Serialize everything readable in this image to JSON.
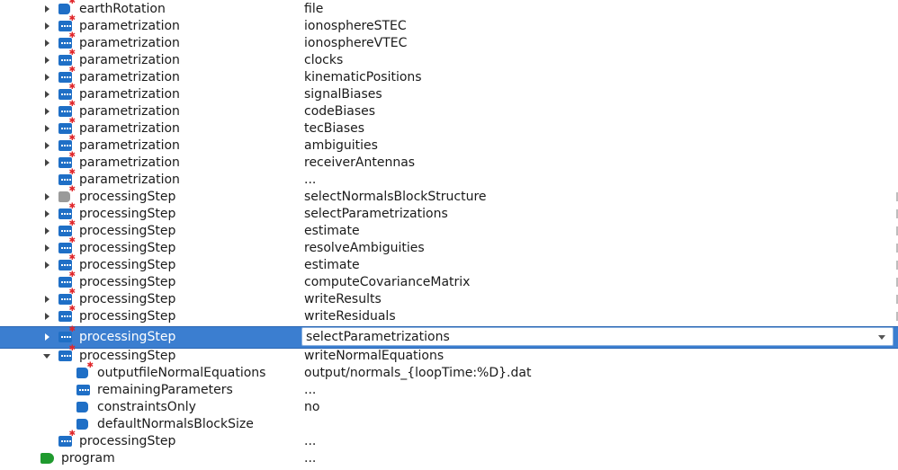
{
  "rows": [
    {
      "name": "earthRotation",
      "value": "file",
      "expander": "collapsed",
      "icon": "tag",
      "indent": 1,
      "icon_name": "file-tag-icon"
    },
    {
      "name": "parametrization",
      "value": "ionosphereSTEC",
      "expander": "collapsed",
      "icon": "list",
      "indent": 1,
      "icon_name": "list-tag-icon"
    },
    {
      "name": "parametrization",
      "value": "ionosphereVTEC",
      "expander": "collapsed",
      "icon": "list",
      "indent": 1,
      "icon_name": "list-tag-icon"
    },
    {
      "name": "parametrization",
      "value": "clocks",
      "expander": "collapsed",
      "icon": "list",
      "indent": 1,
      "icon_name": "list-tag-icon"
    },
    {
      "name": "parametrization",
      "value": "kinematicPositions",
      "expander": "collapsed",
      "icon": "list",
      "indent": 1,
      "icon_name": "list-tag-icon"
    },
    {
      "name": "parametrization",
      "value": "signalBiases",
      "expander": "collapsed",
      "icon": "list",
      "indent": 1,
      "icon_name": "list-tag-icon"
    },
    {
      "name": "parametrization",
      "value": "codeBiases",
      "expander": "collapsed",
      "icon": "list",
      "indent": 1,
      "icon_name": "list-tag-icon"
    },
    {
      "name": "parametrization",
      "value": "tecBiases",
      "expander": "collapsed",
      "icon": "list",
      "indent": 1,
      "icon_name": "list-tag-icon"
    },
    {
      "name": "parametrization",
      "value": "ambiguities",
      "expander": "collapsed",
      "icon": "list",
      "indent": 1,
      "icon_name": "list-tag-icon"
    },
    {
      "name": "parametrization",
      "value": "receiverAntennas",
      "expander": "collapsed",
      "icon": "list",
      "indent": 1,
      "icon_name": "list-tag-icon"
    },
    {
      "name": "parametrization",
      "value": "...",
      "expander": "none",
      "icon": "list",
      "indent": 1,
      "icon_name": "list-tag-icon"
    },
    {
      "name": "processingStep",
      "value": "selectNormalsBlockStructure",
      "expander": "collapsed",
      "icon": "gray",
      "indent": 1,
      "icon_name": "disabled-list-tag-icon"
    },
    {
      "name": "processingStep",
      "value": "selectParametrizations",
      "expander": "collapsed",
      "icon": "list",
      "indent": 1,
      "icon_name": "list-tag-icon"
    },
    {
      "name": "processingStep",
      "value": "estimate",
      "expander": "collapsed",
      "icon": "list",
      "indent": 1,
      "icon_name": "list-tag-icon"
    },
    {
      "name": "processingStep",
      "value": "resolveAmbiguities",
      "expander": "collapsed",
      "icon": "list",
      "indent": 1,
      "icon_name": "list-tag-icon"
    },
    {
      "name": "processingStep",
      "value": "estimate",
      "expander": "collapsed",
      "icon": "list",
      "indent": 1,
      "icon_name": "list-tag-icon"
    },
    {
      "name": "processingStep",
      "value": "computeCovarianceMatrix",
      "expander": "none",
      "icon": "list",
      "indent": 1,
      "icon_name": "list-tag-icon"
    },
    {
      "name": "processingStep",
      "value": "writeResults",
      "expander": "collapsed",
      "icon": "list",
      "indent": 1,
      "icon_name": "list-tag-icon"
    },
    {
      "name": "processingStep",
      "value": "writeResiduals",
      "expander": "collapsed",
      "icon": "list",
      "indent": 1,
      "icon_name": "list-tag-icon"
    },
    {
      "name": "processingStep",
      "value": "selectParametrizations",
      "expander": "collapsed",
      "icon": "list",
      "indent": 1,
      "selected": true,
      "icon_name": "list-tag-icon"
    },
    {
      "name": "processingStep",
      "value": "writeNormalEquations",
      "expander": "expanded",
      "icon": "list",
      "indent": 1,
      "icon_name": "list-tag-icon"
    },
    {
      "name": "outputfileNormalEquations",
      "value": "output/normals_{loopTime:%D}.dat",
      "expander": "none",
      "icon": "tag",
      "indent": 2,
      "icon_name": "file-tag-icon"
    },
    {
      "name": "remainingParameters",
      "value": "...",
      "expander": "none",
      "icon": "list",
      "indent": 2,
      "icon_name": "list-tag-icon"
    },
    {
      "name": "constraintsOnly",
      "value": "no",
      "expander": "none",
      "icon": "tag",
      "indent": 2,
      "icon_name": "bool-tag-icon"
    },
    {
      "name": "defaultNormalsBlockSize",
      "value": "",
      "expander": "none",
      "icon": "tag",
      "indent": 2,
      "icon_name": "number-tag-icon"
    },
    {
      "name": "processingStep",
      "value": "...",
      "expander": "none",
      "icon": "list",
      "indent": 1,
      "icon_name": "list-tag-icon"
    },
    {
      "name": "program",
      "value": "...",
      "expander": "none",
      "icon": "green",
      "indent": 0,
      "icon_name": "program-tag-icon"
    }
  ],
  "colors": {
    "selection": "#3b7ed0",
    "tag_blue": "#1f6fc6",
    "tag_green": "#1f9a2e",
    "required_star": "#e0262a"
  }
}
